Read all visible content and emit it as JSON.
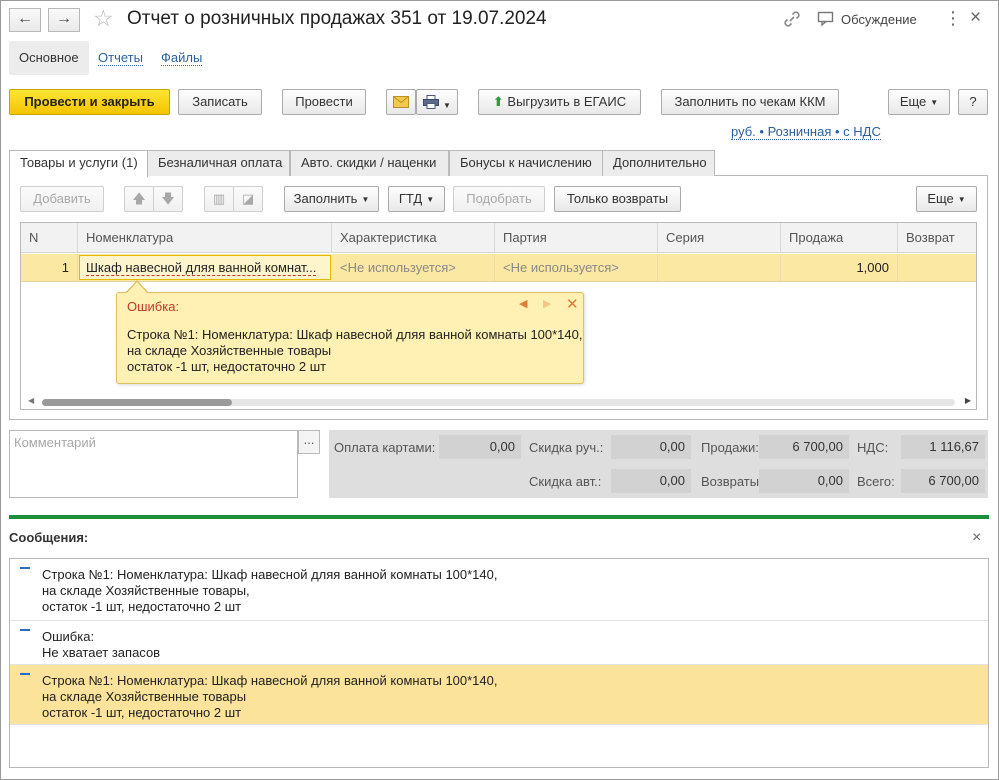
{
  "window": {
    "title": "Отчет о розничных продажах 351 от 19.07.2024",
    "discussion_label": "Обсуждение",
    "more_glyph": "⋮",
    "close_glyph": "×",
    "back_glyph": "←",
    "forward_glyph": "→"
  },
  "section_tabs": [
    "Основное",
    "Отчеты",
    "Файлы"
  ],
  "toolbar": {
    "post_and_close": "Провести и закрыть",
    "save": "Записать",
    "post": "Провести",
    "upload_egais": "Выгрузить в ЕГАИС",
    "fill_by_receipts": "Заполнить по чекам ККМ",
    "more": "Еще",
    "help": "?"
  },
  "price_type_link": "руб. • Розничная • с НДС",
  "inner_tabs": [
    "Товары и услуги (1)",
    "Безналичная оплата",
    "Авто. скидки / наценки",
    "Бонусы к начислению",
    "Дополнительно"
  ],
  "table_toolbar": {
    "add": "Добавить",
    "fill": "Заполнить",
    "gtd": "ГТД",
    "pick": "Подобрать",
    "returns_only": "Только возвраты",
    "more": "Еще"
  },
  "table": {
    "columns": [
      "N",
      "Номенклатура",
      "Характеристика",
      "Партия",
      "Серия",
      "Продажа",
      "Возврат"
    ],
    "rows": [
      {
        "n": "1",
        "item": "Шкаф навесной дляя ванной комнат...",
        "characteristic": "<Не используется>",
        "batch": "<Не используется>",
        "series": "",
        "sale": "1,000",
        "return": ""
      }
    ]
  },
  "error_popup": {
    "title": "Ошибка:",
    "lines": [
      "Строка №1: Номенклатура: Шкаф навесной дляя ванной комнаты 100*140,",
      "на складе Хозяйственные товары",
      "остаток -1 шт, недостаточно 2 шт"
    ],
    "prev_glyph": "◀",
    "next_glyph": "▶",
    "close_glyph": "✕"
  },
  "comment": {
    "placeholder": "Комментарий",
    "button": "..."
  },
  "totals": {
    "card_payment_label": "Оплата картами:",
    "card_payment": "0,00",
    "manual_discount_label": "Скидка руч.:",
    "manual_discount": "0,00",
    "sales_label": "Продажи:",
    "sales": "6 700,00",
    "vat_label": "НДС:",
    "vat": "1 116,67",
    "auto_discount_label": "Скидка авт.:",
    "auto_discount": "0,00",
    "returns_label": "Возвраты:",
    "returns": "0,00",
    "total_label": "Всего:",
    "total": "6 700,00"
  },
  "messages": {
    "title": "Сообщения:",
    "close_glyph": "×",
    "items": [
      {
        "lines": [
          "Строка №1: Номенклатура: Шкаф навесной дляя ванной комнаты 100*140,",
          "на складе Хозяйственные товары,",
          "остаток -1 шт, недостаточно 2 шт"
        ]
      },
      {
        "lines": [
          "Ошибка:",
          "Не хватает запасов"
        ]
      },
      {
        "lines": [
          "Строка №1: Номенклатура: Шкаф навесной дляя ванной комнаты 100*140,",
          "на складе Хозяйственные товары",
          "остаток -1 шт, недостаточно 2 шт"
        ]
      }
    ]
  },
  "colors": {
    "primary_button": "#f4c400",
    "selected_row": "#fbe8a3",
    "popup_bg": "#fff0b3",
    "messages_separator": "#1d8f3c",
    "link": "#2a5fa0"
  }
}
